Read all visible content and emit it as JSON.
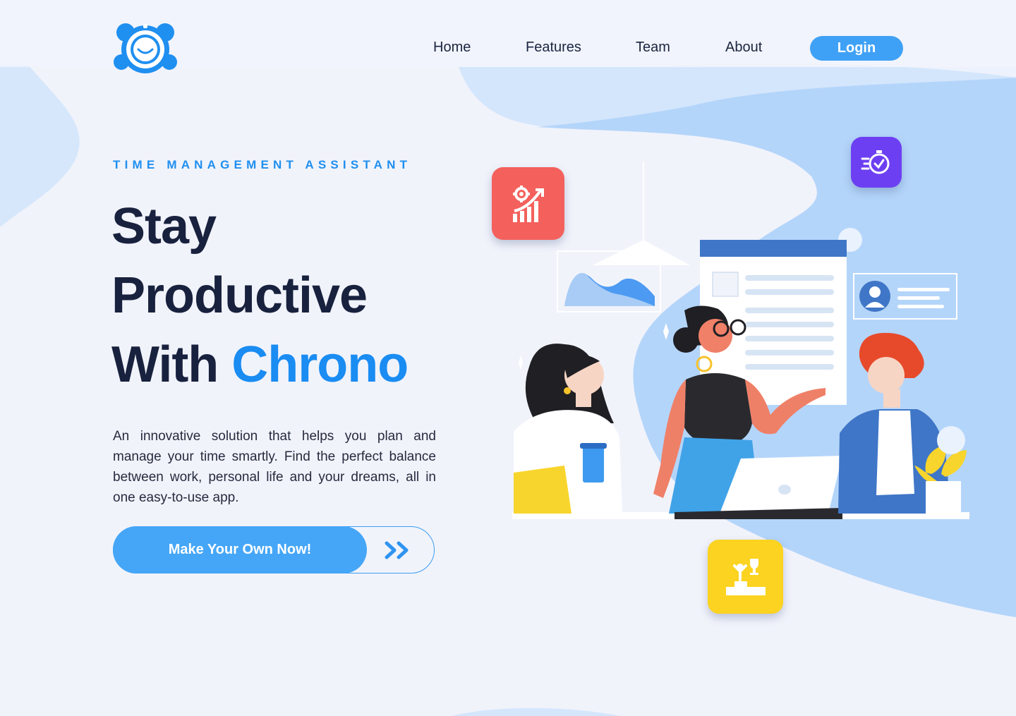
{
  "brand": {
    "logo_icon": "alarm-clock-icon"
  },
  "nav": {
    "links": [
      "Home",
      "Features",
      "Team",
      "About"
    ],
    "login_label": "Login"
  },
  "hero": {
    "eyebrow": "TIME MANAGEMENT ASSISTANT",
    "headline_line1": "Stay",
    "headline_line2": "Productive",
    "headline_line3_prefix": "With ",
    "headline_line3_accent": "Chrono",
    "description": "An innovative solution that helps you plan and manage your time smartly. Find the perfect balance between work, personal life and your dreams, all in one easy-to-use app.",
    "cta_label": "Make Your Own Now!",
    "cta_icon": "double-chevron-right-icon"
  },
  "illustration": {
    "tiles": [
      {
        "icon": "growth-chart-gear-icon",
        "color": "#f4605c"
      },
      {
        "icon": "fast-stopwatch-check-icon",
        "color": "#6d3ff2"
      },
      {
        "icon": "winner-podium-trophy-icon",
        "color": "#fbd320"
      }
    ]
  },
  "colors": {
    "accent": "#1a8cf2",
    "button": "#45a6f7",
    "background": "#f1f3fb",
    "heading": "#18213d"
  }
}
